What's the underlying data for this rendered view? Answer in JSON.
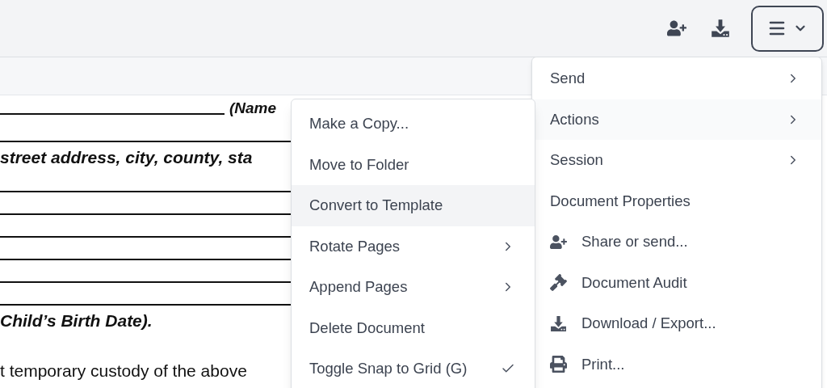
{
  "toolbar": {
    "menu_button": {
      "expanded": true
    }
  },
  "document": {
    "lines": [
      {
        "kind": "blank_then_text",
        "text": "(Name"
      },
      {
        "kind": "rule"
      },
      {
        "kind": "text",
        "text": "street address, city, county, sta"
      },
      {
        "kind": "rule"
      },
      {
        "kind": "rule"
      },
      {
        "kind": "rule"
      },
      {
        "kind": "rule"
      },
      {
        "kind": "rule"
      },
      {
        "kind": "rule"
      },
      {
        "kind": "text",
        "text": "Child’s Birth Date)."
      },
      {
        "kind": "gap"
      },
      {
        "kind": "plain",
        "text": "t temporary custody of the above"
      }
    ]
  },
  "main_menu": {
    "items": [
      {
        "kind": "submenu",
        "label": "Send",
        "selected": false
      },
      {
        "kind": "submenu",
        "label": "Actions",
        "selected": true
      },
      {
        "kind": "submenu",
        "label": "Session",
        "selected": false
      },
      {
        "kind": "plain",
        "label": "Document Properties",
        "selected": false
      },
      {
        "kind": "share",
        "label": "Share or send...",
        "selected": false
      },
      {
        "kind": "audit",
        "label": "Document Audit",
        "selected": false
      },
      {
        "kind": "download",
        "label": "Download / Export...",
        "selected": false
      },
      {
        "kind": "print",
        "label": "Print...",
        "selected": false
      }
    ]
  },
  "actions_menu": {
    "items": [
      {
        "label": "Make a Copy...",
        "selected": false,
        "has_submenu": false,
        "checked": false
      },
      {
        "label": "Move to Folder",
        "selected": false,
        "has_submenu": false,
        "checked": false
      },
      {
        "label": "Convert to Template",
        "selected": true,
        "has_submenu": false,
        "checked": false
      },
      {
        "label": "Rotate Pages",
        "selected": false,
        "has_submenu": true,
        "checked": false
      },
      {
        "label": "Append Pages",
        "selected": false,
        "has_submenu": true,
        "checked": false
      },
      {
        "label": "Delete Document",
        "selected": false,
        "has_submenu": false,
        "checked": false
      },
      {
        "label": "Toggle Snap to Grid (G)",
        "selected": false,
        "has_submenu": false,
        "checked": true
      }
    ]
  }
}
